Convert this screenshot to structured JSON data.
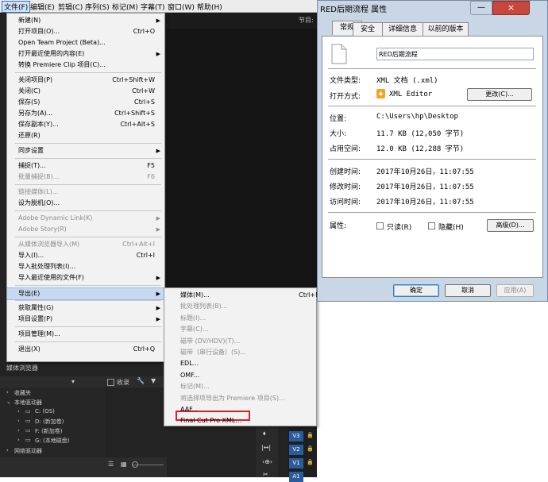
{
  "menubar": {
    "items": [
      "文件(F)",
      "编辑(E)",
      "剪辑(C)",
      "序列(S)",
      "标记(M)",
      "字幕(T)",
      "窗口(W)",
      "帮助(H)"
    ]
  },
  "app": {
    "node_label": "节目:",
    "media_browser_title": "媒体浏览器",
    "collect_label": "收录",
    "tree": {
      "favorites": "收藏夹",
      "local_drives": "本地驱动器",
      "drive_c": "C: (OS)",
      "drive_d": "D: (新加卷)",
      "drive_f": "F: (新加卷)",
      "drive_g": "G: (本地磁盘)",
      "network_drives": "网络驱动器"
    },
    "tracks": [
      "V3",
      "V2",
      "V1",
      "A1"
    ]
  },
  "file_menu": {
    "items": [
      {
        "label": "新建(N)",
        "shortcut": "",
        "arrow": true,
        "disabled": false
      },
      {
        "label": "打开项目(O)...",
        "shortcut": "Ctrl+O",
        "arrow": false,
        "disabled": false
      },
      {
        "label": "Open Team Project (Beta)...",
        "shortcut": "",
        "arrow": false,
        "disabled": false
      },
      {
        "label": "打开最近使用的内容(E)",
        "shortcut": "",
        "arrow": true,
        "disabled": false
      },
      {
        "label": "转换 Premiere Clip 项目(C)...",
        "shortcut": "",
        "arrow": false,
        "disabled": false
      },
      {
        "label": "关闭项目(P)",
        "shortcut": "Ctrl+Shift+W",
        "arrow": false,
        "disabled": false
      },
      {
        "label": "关闭(C)",
        "shortcut": "Ctrl+W",
        "arrow": false,
        "disabled": false
      },
      {
        "label": "保存(S)",
        "shortcut": "Ctrl+S",
        "arrow": false,
        "disabled": false
      },
      {
        "label": "另存为(A)...",
        "shortcut": "Ctrl+Shift+S",
        "arrow": false,
        "disabled": false
      },
      {
        "label": "保存副本(Y)...",
        "shortcut": "Ctrl+Alt+S",
        "arrow": false,
        "disabled": false
      },
      {
        "label": "还原(R)",
        "shortcut": "",
        "arrow": false,
        "disabled": false
      },
      {
        "label": "同步设置",
        "shortcut": "",
        "arrow": true,
        "disabled": false
      },
      {
        "label": "捕捉(T)...",
        "shortcut": "F5",
        "arrow": false,
        "disabled": false
      },
      {
        "label": "批量捕捉(B)...",
        "shortcut": "F6",
        "arrow": false,
        "disabled": true
      },
      {
        "label": "链接媒体(L)...",
        "shortcut": "",
        "arrow": false,
        "disabled": true
      },
      {
        "label": "设为脱机(O)...",
        "shortcut": "",
        "arrow": false,
        "disabled": false
      },
      {
        "label": "Adobe Dynamic Link(K)",
        "shortcut": "",
        "arrow": true,
        "disabled": true
      },
      {
        "label": "Adobe Story(R)",
        "shortcut": "",
        "arrow": true,
        "disabled": true
      },
      {
        "label": "从媒体浏览器导入(M)",
        "shortcut": "Ctrl+Alt+I",
        "arrow": false,
        "disabled": true
      },
      {
        "label": "导入(I)...",
        "shortcut": "Ctrl+I",
        "arrow": false,
        "disabled": false
      },
      {
        "label": "导入批处理列表(I)...",
        "shortcut": "",
        "arrow": false,
        "disabled": false
      },
      {
        "label": "导入最近使用的文件(F)",
        "shortcut": "",
        "arrow": true,
        "disabled": false
      },
      {
        "label": "导出(E)",
        "shortcut": "",
        "arrow": true,
        "disabled": false
      },
      {
        "label": "获取属性(G)",
        "shortcut": "",
        "arrow": true,
        "disabled": false
      },
      {
        "label": "项目设置(P)",
        "shortcut": "",
        "arrow": true,
        "disabled": false
      },
      {
        "label": "项目管理(M)...",
        "shortcut": "",
        "arrow": false,
        "disabled": false
      },
      {
        "label": "退出(X)",
        "shortcut": "Ctrl+Q",
        "arrow": false,
        "disabled": false
      }
    ]
  },
  "export_menu": {
    "items": [
      {
        "label": "媒体(M)...",
        "shortcut": "Ctrl+M",
        "disabled": false
      },
      {
        "label": "批处理列表(B)...",
        "shortcut": "",
        "disabled": true
      },
      {
        "label": "标题(I)...",
        "shortcut": "",
        "disabled": true
      },
      {
        "label": "字幕(C)...",
        "shortcut": "",
        "disabled": true
      },
      {
        "label": "磁带 (DV/HDV)(T)...",
        "shortcut": "",
        "disabled": true
      },
      {
        "label": "磁带（串行设备）(S)...",
        "shortcut": "",
        "disabled": true
      },
      {
        "label": "EDL...",
        "shortcut": "",
        "disabled": false
      },
      {
        "label": "OMF...",
        "shortcut": "",
        "disabled": false
      },
      {
        "label": "标记(M)...",
        "shortcut": "",
        "disabled": true
      },
      {
        "label": "将选择项导出为 Premiere 项目(S)...",
        "shortcut": "",
        "disabled": true
      },
      {
        "label": "AAF...",
        "shortcut": "",
        "disabled": false
      },
      {
        "label": "Final Cut Pro XML...",
        "shortcut": "",
        "disabled": false
      }
    ]
  },
  "dialog": {
    "title": "RED后期流程 属性",
    "close_glyph": "×",
    "min_glyph": "—",
    "tabs": [
      "常规",
      "安全",
      "详细信息",
      "以前的版本"
    ],
    "filename": "RED后期流程",
    "rows": {
      "type_label": "文件类型:",
      "type_value": "XML 文档 (.xml)",
      "open_label": "打开方式:",
      "open_value": "XML Editor",
      "change_button": "更改(C)...",
      "location_label": "位置:",
      "location_value": "C:\\Users\\hp\\Desktop",
      "size_label": "大小:",
      "size_value": "11.7 KB (12,050 字节)",
      "disk_label": "占用空间:",
      "disk_value": "12.0 KB (12,288 字节)",
      "created_label": "创建时间:",
      "created_value": "2017年10月26日，11:07:55",
      "modified_label": "修改时间:",
      "modified_value": "2017年10月26日，11:07:55",
      "accessed_label": "访问时间:",
      "accessed_value": "2017年10月26日，11:07:55",
      "attr_label": "属性:",
      "readonly_label": "只读(R)",
      "hidden_label": "隐藏(H)",
      "advanced_button": "高级(D)..."
    },
    "buttons": {
      "ok": "确定",
      "cancel": "取消",
      "apply": "应用(A)"
    }
  },
  "colors": {
    "highlight_box": "#e02020",
    "dialog_frame": "#c8d6e6",
    "close_button": "#c9463d"
  }
}
